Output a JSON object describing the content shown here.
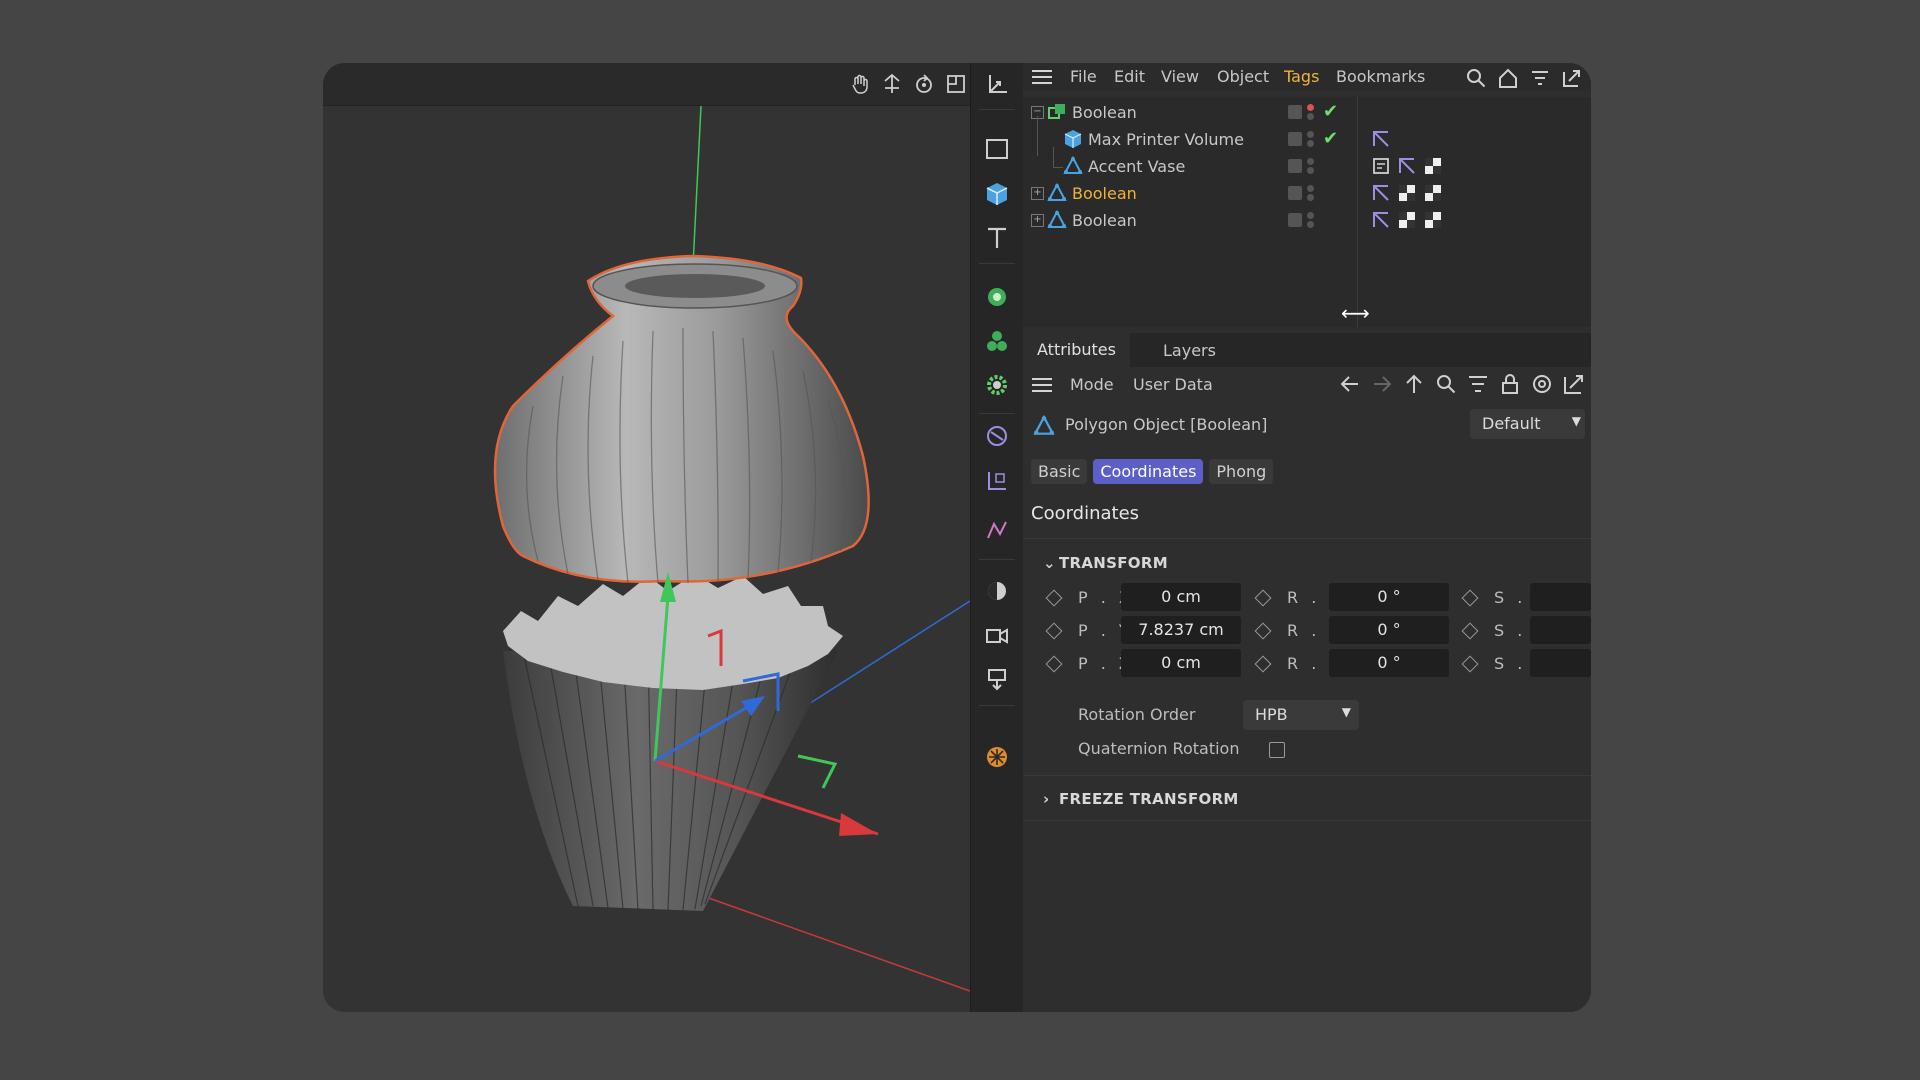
{
  "menubar": {
    "items": [
      "File",
      "Edit",
      "View",
      "Object",
      "Tags",
      "Bookmarks"
    ],
    "active_item": "Tags"
  },
  "object_tree": {
    "rows": [
      {
        "label": "Boolean",
        "highlighted": false,
        "enabled": true
      },
      {
        "label": "Max Printer Volume",
        "highlighted": false,
        "enabled": true
      },
      {
        "label": "Accent Vase",
        "highlighted": false,
        "enabled": false
      },
      {
        "label": "Boolean",
        "highlighted": true,
        "enabled": false
      },
      {
        "label": "Boolean",
        "highlighted": false,
        "enabled": false
      }
    ]
  },
  "attributes": {
    "tabs": [
      "Attributes",
      "Layers"
    ],
    "toolbar": {
      "mode": "Mode",
      "user_data": "User Data"
    },
    "object_title": "Polygon Object [Boolean]",
    "preset": "Default",
    "subtabs": [
      "Basic",
      "Coordinates",
      "Phong"
    ],
    "active_subtab": "Coordinates",
    "section_title": "Coordinates",
    "transform_group": "TRANSFORM",
    "freeze_group": "FREEZE TRANSFORM",
    "position": {
      "x_label": "P . X",
      "x": "0 cm",
      "y_label": "P . Y",
      "y": "7.8237 cm",
      "z_label": "P . Z",
      "z": "0 cm"
    },
    "rotation": {
      "h_label": "R . H",
      "h": "0 °",
      "p_label": "R . P",
      "p": "0 °",
      "b_label": "R . B",
      "b": "0 °"
    },
    "scale": {
      "x_label": "S . X",
      "y_label": "S . Y",
      "z_label": "S . Z"
    },
    "rotation_order_label": "Rotation Order",
    "rotation_order": "HPB",
    "quaternion_label": "Quaternion Rotation",
    "quaternion_checked": false
  },
  "colors": {
    "accent_tab": "#5d5fc8",
    "highlight_text": "#f0b23a",
    "selection_outline": "#e0663a",
    "axis_x": "#d8393a",
    "axis_y": "#3ec85a",
    "axis_z": "#2f6ad8",
    "enabled_check": "#6fdd6f"
  }
}
